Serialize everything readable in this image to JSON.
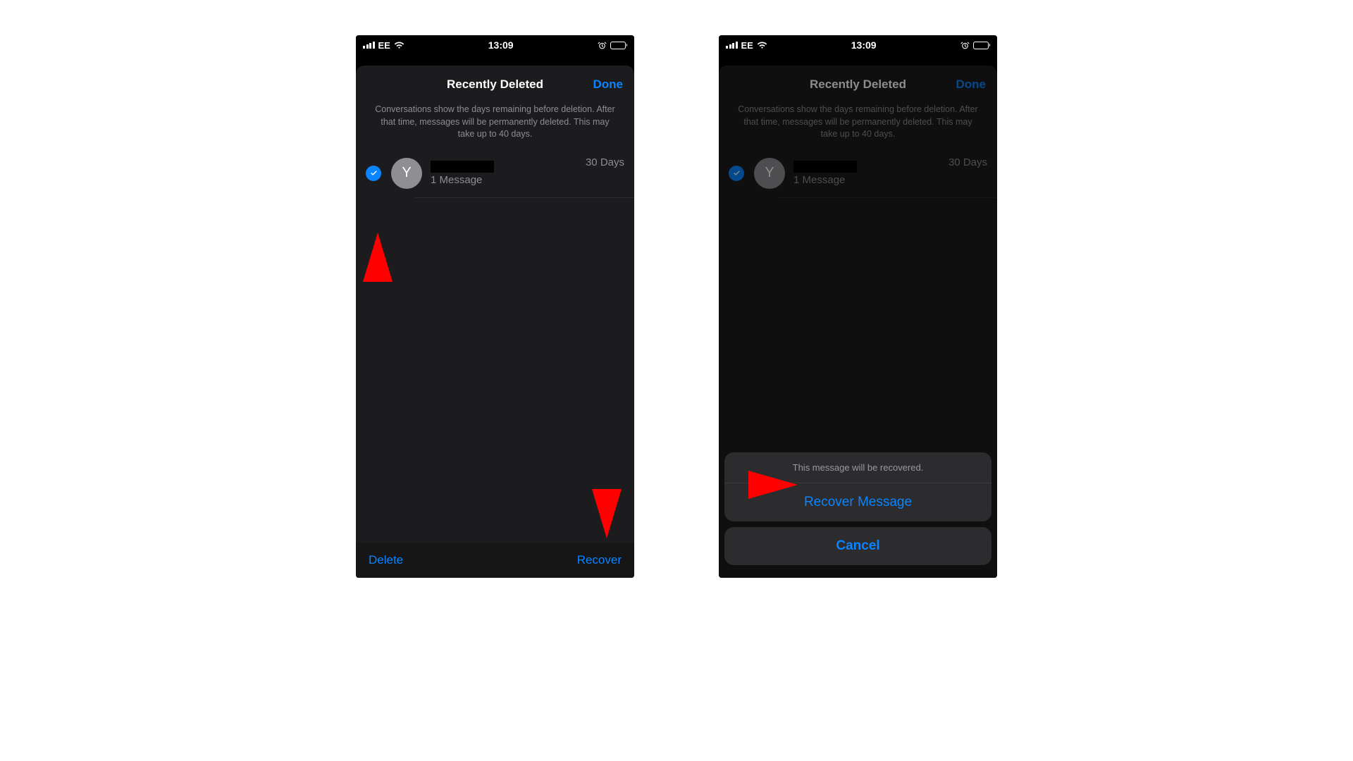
{
  "status": {
    "carrier": "EE",
    "time": "13:09"
  },
  "sheet": {
    "title": "Recently Deleted",
    "done": "Done",
    "info": "Conversations show the days remaining before deletion. After that time, messages will be permanently deleted. This may take up to 40 days."
  },
  "conversation": {
    "avatar_letter": "Y",
    "message_count": "1 Message",
    "days": "30 Days"
  },
  "toolbar": {
    "delete": "Delete",
    "recover": "Recover"
  },
  "actionsheet": {
    "title": "This message will be recovered.",
    "recover": "Recover Message",
    "cancel": "Cancel"
  }
}
